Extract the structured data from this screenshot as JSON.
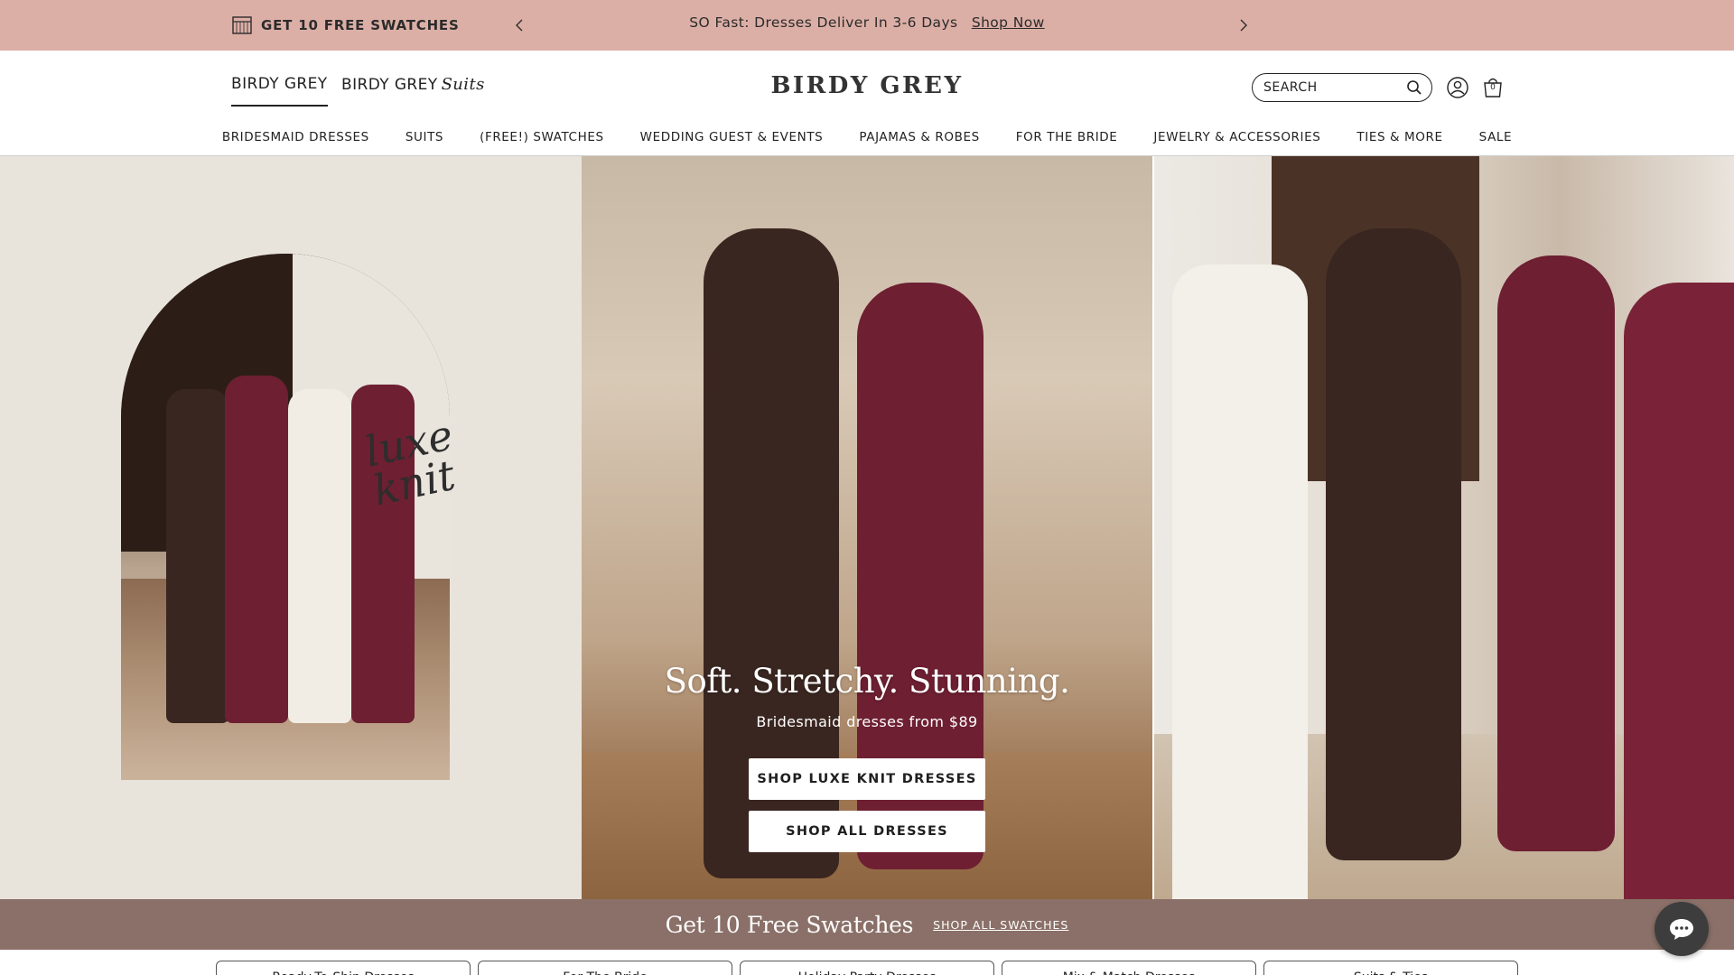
{
  "announcement": {
    "swatch_promo": "GET 10 FREE SWATCHES",
    "message": "SO Fast: Dresses Deliver In 3-6 Days",
    "link": "Shop Now"
  },
  "header": {
    "brand_tabs": [
      "BIRDY GREY",
      "BIRDY GREY"
    ],
    "suits_script": "Suits",
    "logo": "BIRDY GREY",
    "search": {
      "placeholder": "SEARCH",
      "value": ""
    },
    "bag_count": "0"
  },
  "nav": {
    "items": [
      "BRIDESMAID DRESSES",
      "SUITS",
      "(FREE!) SWATCHES",
      "WEDDING GUEST & EVENTS",
      "PAJAMAS & ROBES",
      "FOR THE BRIDE",
      "JEWELRY & ACCESSORIES",
      "TIES & MORE",
      "SALE"
    ]
  },
  "hero": {
    "script": "luxe knit",
    "title": "Soft. Stretchy. Stunning.",
    "subtitle": "Bridesmaid dresses from $89",
    "primary_button": "SHOP LUXE KNIT DRESSES",
    "secondary_button": "SHOP ALL DRESSES"
  },
  "swatch_strip": {
    "title": "Get 10 Free Swatches",
    "link": "SHOP ALL SWATCHES"
  },
  "category_cards": [
    "Ready-To-Ship Dresses",
    "For The Bride",
    "Holiday Party Dresses",
    "Mix & Match Dresses",
    "Suits & Ties"
  ],
  "colors": {
    "announcement_bg": "#dcafa6",
    "swatch_strip_bg": "#8a7068",
    "dress_burgundy": "#6e1f32",
    "dress_chocolate": "#3a2620"
  }
}
